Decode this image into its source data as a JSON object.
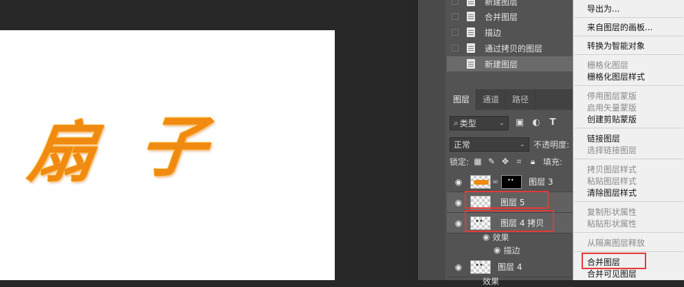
{
  "canvas": {
    "artwork_chars": [
      "扇",
      "子"
    ]
  },
  "history": {
    "items": [
      {
        "label": "新建图层"
      },
      {
        "label": "合并图层"
      },
      {
        "label": "描边"
      },
      {
        "label": "通过拷贝的图层"
      },
      {
        "label": "新建图层"
      }
    ]
  },
  "layers_panel": {
    "tabs": [
      {
        "label": "图层"
      },
      {
        "label": "通道"
      },
      {
        "label": "路径"
      }
    ],
    "filter": {
      "label": "类型"
    },
    "blend_mode": "正常",
    "opacity_label": "不透明度:",
    "lock_label": "锁定:",
    "fill_label": "填充:",
    "layers": [
      {
        "name": "图层 3"
      },
      {
        "name": "图层 5"
      },
      {
        "name": "图层 4 拷贝"
      },
      {
        "name": "图层 4"
      }
    ],
    "effects_label": "效果",
    "stroke_label": "描边",
    "effects_label_2": "效果"
  },
  "context_menu": {
    "items": [
      {
        "label": "导出为..."
      },
      {
        "label": "来自图层的画板..."
      },
      {
        "label": "转换为智能对象"
      },
      {
        "label": "栅格化图层"
      },
      {
        "label": "栅格化图层样式"
      },
      {
        "label": "停用图层蒙版"
      },
      {
        "label": "启用矢量蒙版"
      },
      {
        "label": "创建剪贴蒙版"
      },
      {
        "label": "链接图层"
      },
      {
        "label": "选择链接图层"
      },
      {
        "label": "拷贝图层样式"
      },
      {
        "label": "粘贴图层样式"
      },
      {
        "label": "清除图层样式"
      },
      {
        "label": "复制形状属性"
      },
      {
        "label": "粘贴形状属性"
      },
      {
        "label": "从隔离图层释放"
      },
      {
        "label": "合并图层"
      },
      {
        "label": "合并可见图层"
      }
    ]
  }
}
